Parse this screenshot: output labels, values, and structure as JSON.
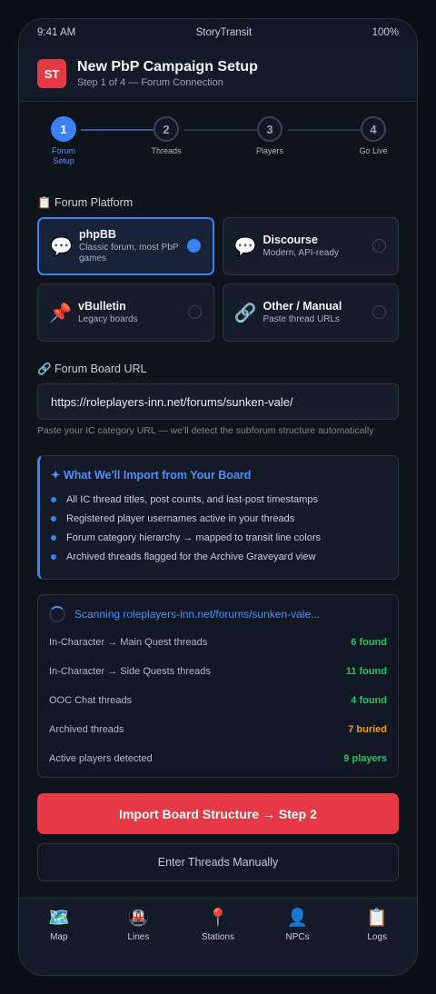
{
  "status": {
    "time": "9:41 AM",
    "app": "StoryTransit",
    "battery": "100%"
  },
  "header": {
    "logo": "ST",
    "title": "New PbP Campaign Setup",
    "subtitle": "Step 1 of 4 — Forum Connection"
  },
  "steps": [
    {
      "num": "1",
      "label": "Forum Setup",
      "active": true
    },
    {
      "num": "2",
      "label": "Threads"
    },
    {
      "num": "3",
      "label": "Players"
    },
    {
      "num": "4",
      "label": "Go Live"
    }
  ],
  "platform": {
    "heading": "📋 Forum Platform",
    "options": [
      {
        "icon": "💬",
        "icon_name": "speech-bubble-icon",
        "title": "phpBB",
        "desc": "Classic forum, most PbP games",
        "selected": true
      },
      {
        "icon": "💬",
        "icon_name": "chat-bubble-icon",
        "title": "Discourse",
        "desc": "Modern, API-ready"
      },
      {
        "icon": "📌",
        "icon_name": "pushpin-icon",
        "title": "vBulletin",
        "desc": "Legacy boards"
      },
      {
        "icon": "🔗",
        "icon_name": "link-icon",
        "title": "Other / Manual",
        "desc": "Paste thread URLs"
      }
    ]
  },
  "url": {
    "heading": "🔗 Forum Board URL",
    "value": "https://roleplayers-inn.net/forums/sunken-vale/",
    "hint": "Paste your IC category URL — we'll detect the subforum structure automatically"
  },
  "import": {
    "title": "✦ What We'll Import from Your Board",
    "items": [
      "All IC thread titles, post counts, and last-post timestamps",
      "Registered player usernames active in your threads",
      "Forum category hierarchy → mapped to transit line colors",
      "Archived threads flagged for the Archive Graveyard view"
    ]
  },
  "scan": {
    "status": "Scanning roleplayers-inn.net/forums/sunken-vale...",
    "rows": [
      {
        "label": "In-Character → Main Quest threads",
        "value": "6 found",
        "color": "green"
      },
      {
        "label": "In-Character → Side Quests threads",
        "value": "11 found",
        "color": "green"
      },
      {
        "label": "OOC Chat threads",
        "value": "4 found",
        "color": "green"
      },
      {
        "label": "Archived threads",
        "value": "7 buried",
        "color": "orange"
      },
      {
        "label": "Active players detected",
        "value": "9 players",
        "color": "green"
      }
    ]
  },
  "buttons": {
    "primary": "Import Board Structure → Step 2",
    "secondary": "Enter Threads Manually"
  },
  "tabs": [
    {
      "icon": "🗺️",
      "icon_name": "map-icon",
      "label": "Map"
    },
    {
      "icon": "🚇",
      "icon_name": "metro-icon",
      "label": "Lines"
    },
    {
      "icon": "📍",
      "icon_name": "location-pin-icon",
      "label": "Stations"
    },
    {
      "icon": "👤",
      "icon_name": "person-icon",
      "label": "NPCs"
    },
    {
      "icon": "📋",
      "icon_name": "clipboard-icon",
      "label": "Logs"
    }
  ],
  "colors": {
    "accent": "#3b82f6",
    "brand": "#e53946",
    "found": "#22c55e",
    "buried": "#f59e0b"
  }
}
